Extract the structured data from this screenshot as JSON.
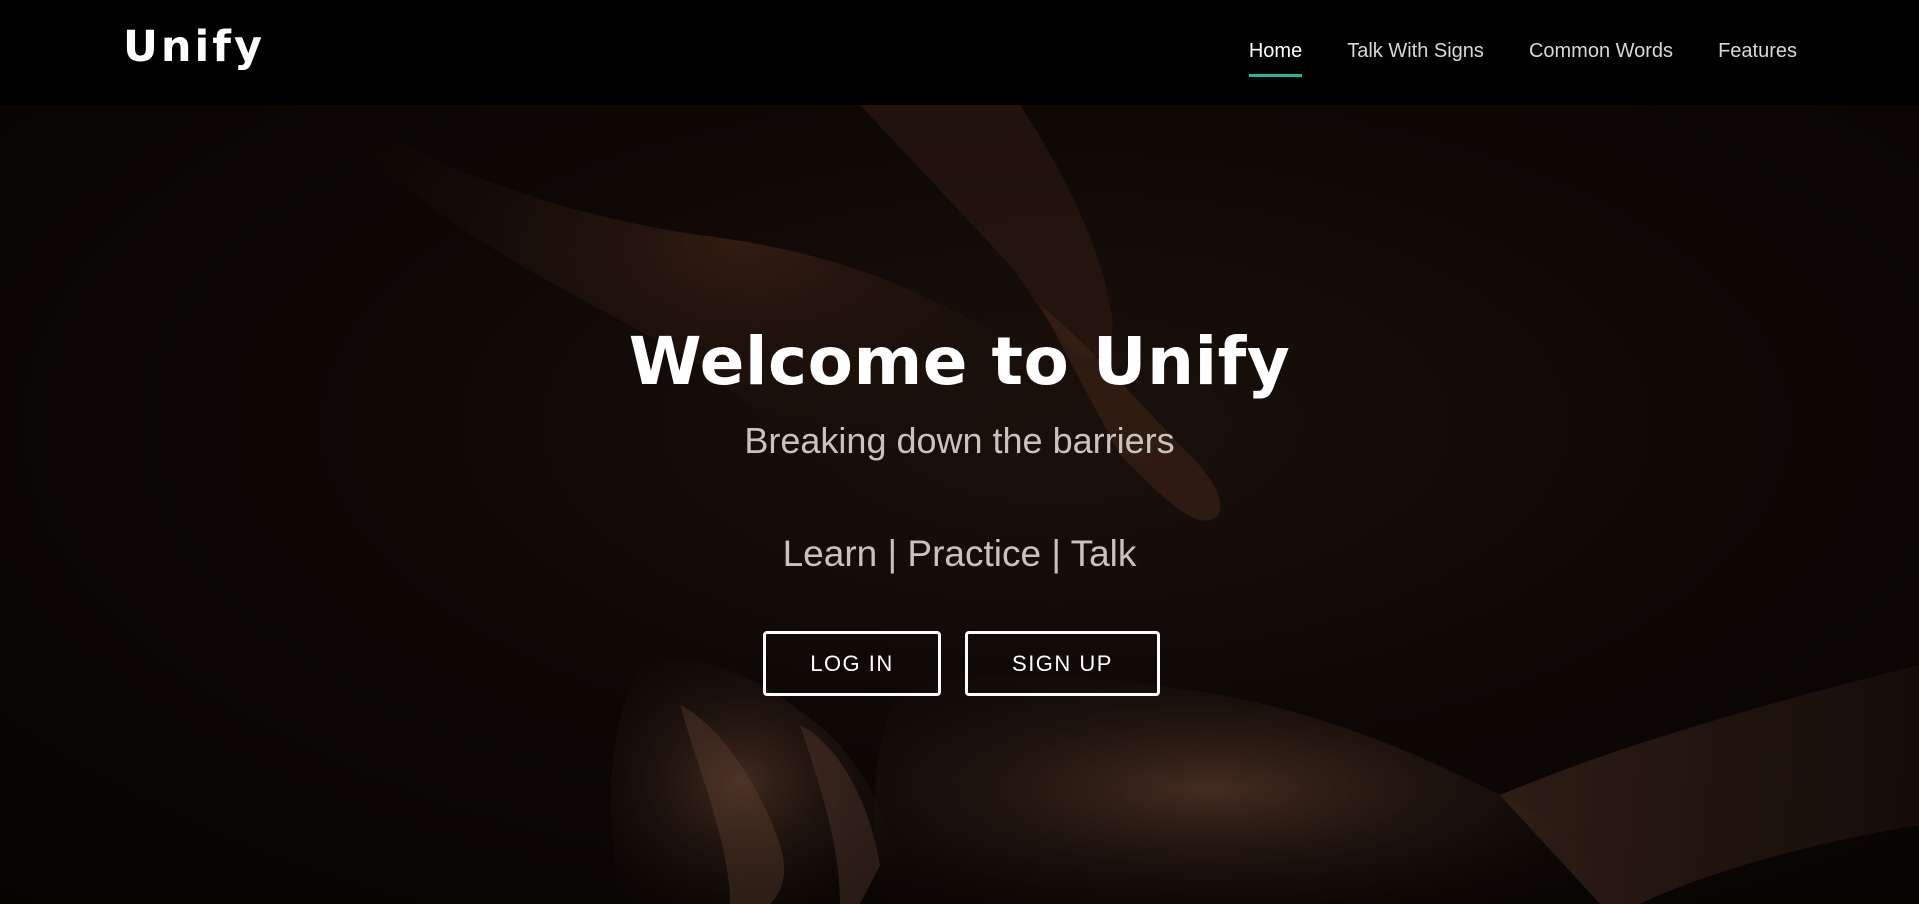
{
  "brand": "Unify",
  "nav": {
    "items": [
      {
        "label": "Home",
        "active": true
      },
      {
        "label": "Talk With Signs",
        "active": false
      },
      {
        "label": "Common Words",
        "active": false
      },
      {
        "label": "Features",
        "active": false
      }
    ],
    "active_underline_color": "#1abc9c"
  },
  "hero": {
    "title": "Welcome to Unify",
    "subtitle": "Breaking down the barriers",
    "tagline": "Learn | Practice | Talk",
    "login_label": "LOG IN",
    "signup_label": "SIGN UP",
    "background_image": "two-hands-reaching-icon"
  },
  "colors": {
    "navbar_bg": "#000000",
    "text_primary": "#ffffff",
    "text_secondary": "#c9c3bd",
    "accent": "#1abc9c"
  }
}
